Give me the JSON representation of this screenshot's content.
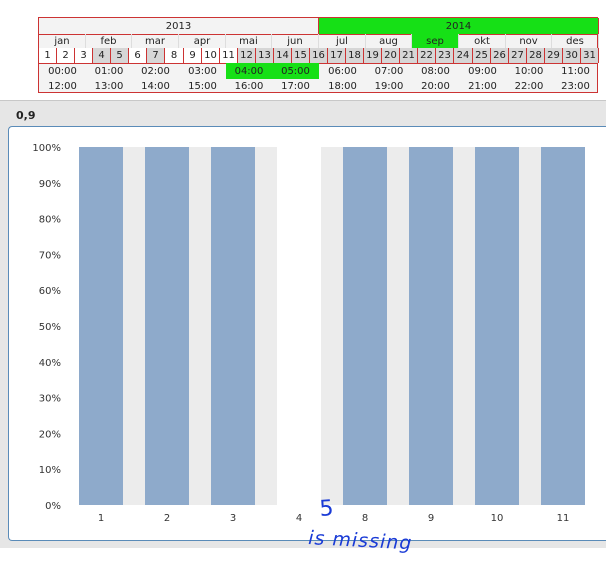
{
  "selector": {
    "years": [
      {
        "label": "2013",
        "selected": false
      },
      {
        "label": "2014",
        "selected": true
      }
    ],
    "months": [
      {
        "label": "jan",
        "selected": false
      },
      {
        "label": "feb",
        "selected": false
      },
      {
        "label": "mar",
        "selected": false
      },
      {
        "label": "apr",
        "selected": false
      },
      {
        "label": "mai",
        "selected": false
      },
      {
        "label": "jun",
        "selected": false
      },
      {
        "label": "jul",
        "selected": false
      },
      {
        "label": "aug",
        "selected": false
      },
      {
        "label": "sep",
        "selected": true
      },
      {
        "label": "okt",
        "selected": false
      },
      {
        "label": "nov",
        "selected": false
      },
      {
        "label": "des",
        "selected": false
      }
    ],
    "days": [
      "1",
      "2",
      "3",
      "4",
      "5",
      "6",
      "7",
      "8",
      "9",
      "10",
      "11",
      "12",
      "13",
      "14",
      "15",
      "16",
      "17",
      "18",
      "19",
      "20",
      "21",
      "22",
      "23",
      "24",
      "25",
      "26",
      "27",
      "28",
      "29",
      "30",
      "31"
    ],
    "hours_row1": [
      {
        "label": "00:00",
        "selected": false
      },
      {
        "label": "01:00",
        "selected": false
      },
      {
        "label": "02:00",
        "selected": false
      },
      {
        "label": "03:00",
        "selected": false
      },
      {
        "label": "04:00",
        "selected": true
      },
      {
        "label": "05:00",
        "selected": true
      },
      {
        "label": "06:00",
        "selected": false
      },
      {
        "label": "07:00",
        "selected": false
      },
      {
        "label": "08:00",
        "selected": false
      },
      {
        "label": "09:00",
        "selected": false
      },
      {
        "label": "10:00",
        "selected": false
      },
      {
        "label": "11:00",
        "selected": false
      }
    ],
    "hours_row2": [
      "12:00",
      "13:00",
      "14:00",
      "15:00",
      "16:00",
      "17:00",
      "18:00",
      "19:00",
      "20:00",
      "21:00",
      "22:00",
      "23:00"
    ],
    "colors": {
      "selected": "#16e016",
      "border": "#cc3333"
    }
  },
  "panel": {
    "title": "0,9"
  },
  "chart_data": {
    "type": "bar",
    "categories": [
      "1",
      "2",
      "3",
      "4",
      "8",
      "9",
      "10",
      "11"
    ],
    "values": [
      100,
      100,
      100,
      0,
      100,
      100,
      100,
      100
    ],
    "ylim": [
      0,
      100
    ],
    "yticks": [
      "0%",
      "10%",
      "20%",
      "30%",
      "40%",
      "50%",
      "60%",
      "70%",
      "80%",
      "90%",
      "100%"
    ],
    "grid": false,
    "bar_color": "#8eaacb",
    "band_color": "#ececec"
  },
  "annotation": {
    "line1": "5",
    "line2": "is missing"
  }
}
